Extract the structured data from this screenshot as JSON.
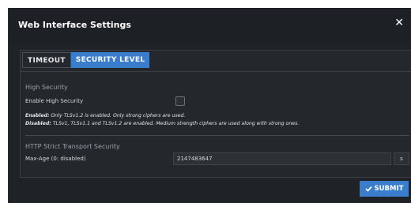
{
  "dialog": {
    "title": "Web Interface Settings",
    "close_glyph": "✕"
  },
  "tabs": [
    {
      "label": "TIMEOUT",
      "active": false
    },
    {
      "label": "SECURITY LEVEL",
      "active": true
    }
  ],
  "high_security": {
    "section_title": "High Security",
    "enable_label": "Enable High Security",
    "enabled": false,
    "enabled_prefix": "Enabled:",
    "enabled_text": " Only TLSv1.2 is enabled. Only strong ciphers are used.",
    "disabled_prefix": "Disabled:",
    "disabled_text": " TLSv1, TLSv1.1 and TLSv1.2 are enabled. Medium strength ciphers are used along with strong ones."
  },
  "hsts": {
    "section_title": "HTTP Strict Transport Security",
    "max_age_label": "Max-Age (0: disabled)",
    "max_age_value": "2147483647",
    "unit": "s"
  },
  "footer": {
    "submit_label": "SUBMIT",
    "submit_icon": "check-icon"
  },
  "colors": {
    "accent": "#3a7dcc",
    "background": "#1f2226"
  }
}
